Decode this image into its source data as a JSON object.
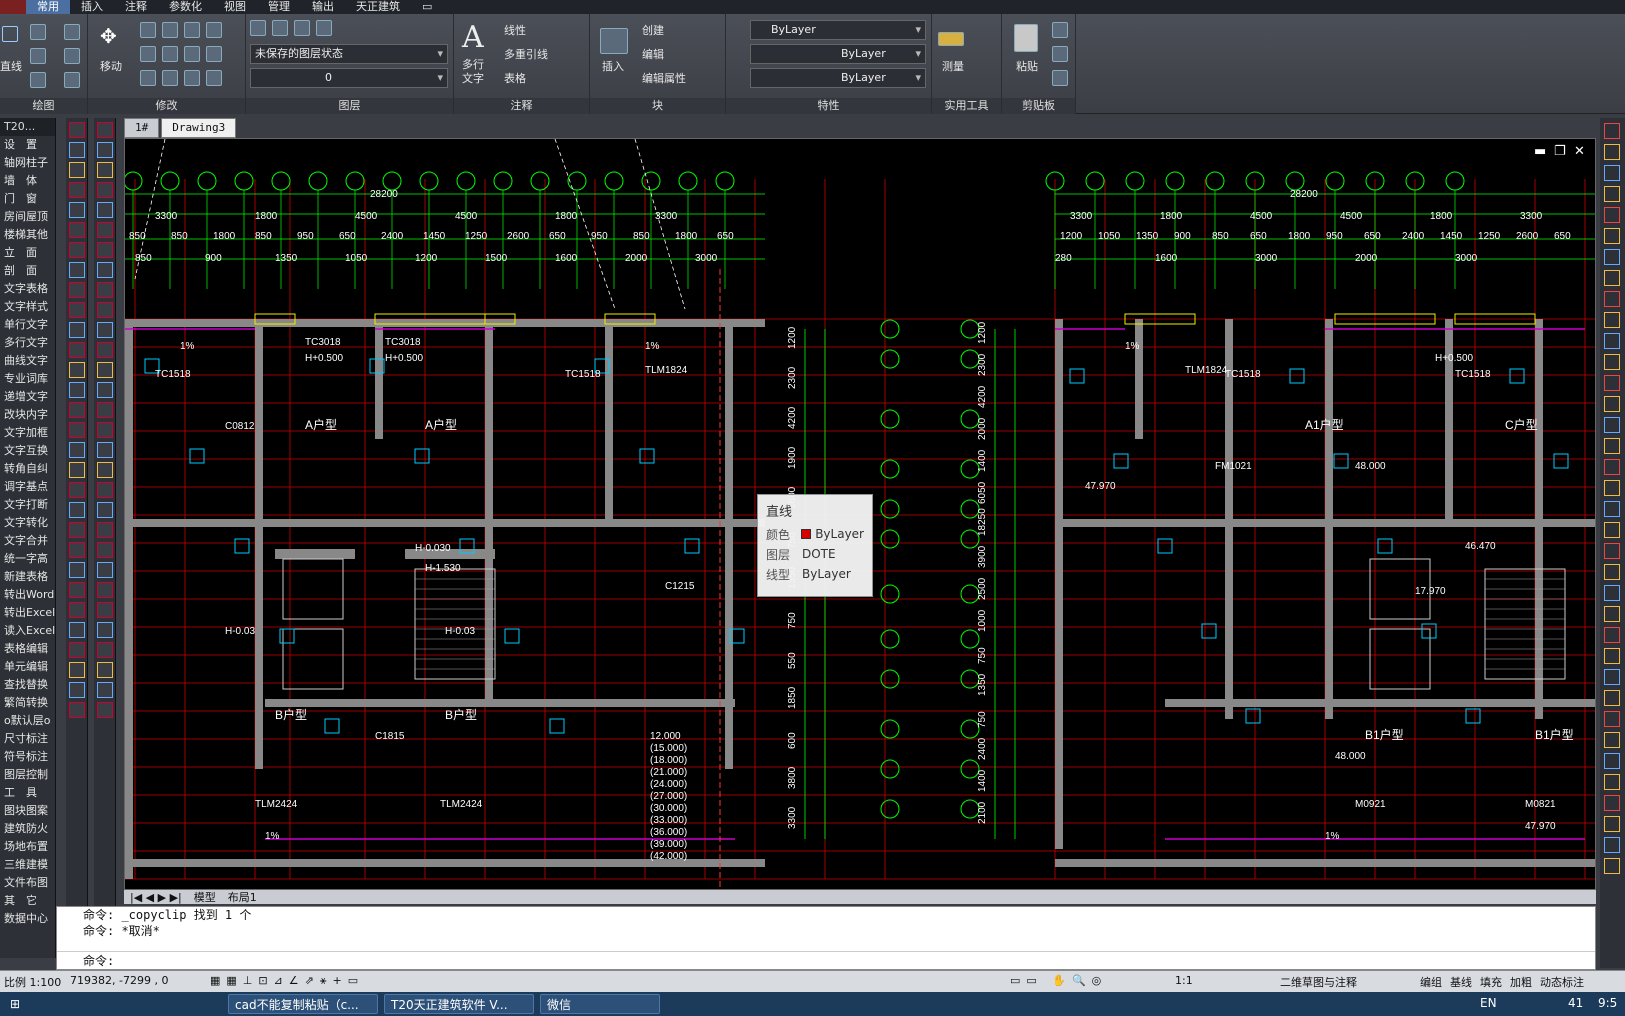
{
  "menu": {
    "tabs": [
      "常用",
      "插入",
      "注释",
      "参数化",
      "视图",
      "管理",
      "输出",
      "天正建筑"
    ]
  },
  "ribbon": {
    "panels": {
      "draw": "绘图",
      "modify": "修改",
      "layers": "图层",
      "annotation": "注释",
      "block": "块",
      "properties": "特性",
      "utilities": "实用工具",
      "clipboard": "剪贴板"
    },
    "draw_line_label": "直线",
    "move_label": "移动",
    "layer_state": "未保存的图层状态",
    "layer_current": "0",
    "multiline_text_label": "多行\n文字",
    "linear_label": "线性",
    "multileader_label": "多重引线",
    "table_label": "表格",
    "insert_label": "插入",
    "create_label": "创建",
    "edit_label": "编辑",
    "edit_attr_label": "编辑属性",
    "color_value": "ByLayer",
    "linetype_value": "ByLayer",
    "lineweight_value": "ByLayer",
    "measure_label": "测量",
    "paste_label": "粘贴"
  },
  "left_palette": {
    "header": "T20...",
    "items": [
      "设　置",
      "轴网柱子",
      "墙　体",
      "门　窗",
      "房间屋顶",
      "楼梯其他",
      "立　面",
      "剖　面",
      "文字表格",
      "文字样式",
      "单行文字",
      "多行文字",
      "曲线文字",
      "专业词库",
      "递增文字",
      "改块内字",
      "文字加框",
      "文字互换",
      "转角自纠",
      "调字基点",
      "文字打断",
      "文字转化",
      "文字合并",
      "统一字高",
      "新建表格",
      "转出Word",
      "转出Excel",
      "读入Excel",
      "表格编辑",
      "单元编辑",
      "查找替换",
      "繁简转换",
      "o默认层o",
      "尺寸标注",
      "符号标注",
      "图层控制",
      "工　具",
      "图块图案",
      "建筑防火",
      "场地布置",
      "三维建模",
      "文件布图",
      "其　它",
      "数据中心"
    ]
  },
  "document": {
    "tabs": [
      "1#",
      "Drawing3"
    ],
    "layout_tabs": [
      "模型",
      "布局1"
    ]
  },
  "tooltip": {
    "title": "直线",
    "color_key": "颜色",
    "color_val": "ByLayer",
    "layer_key": "图层",
    "layer_val": "DOTE",
    "linetype_key": "线型",
    "linetype_val": "ByLayer",
    "swatch_color": "#e00000"
  },
  "drawing": {
    "dims_top_left": [
      "28200",
      "3300",
      "1800",
      "4500",
      "4500",
      "1800",
      "3300",
      "850",
      "850",
      "1800",
      "850",
      "950",
      "650",
      "2400",
      "1450",
      "1250",
      "2600",
      "650",
      "950",
      "850",
      "1800",
      "650",
      "850",
      "900",
      "1350",
      "1050",
      "1200",
      "1500",
      "1600",
      "2000",
      "3000"
    ],
    "dims_top_right": [
      "28200",
      "3300",
      "1800",
      "4500",
      "4500",
      "1800",
      "3300",
      "1200",
      "1050",
      "1350",
      "900",
      "850",
      "650",
      "1800",
      "950",
      "650",
      "2400",
      "1450",
      "1250",
      "2600",
      "650",
      "280",
      "1600",
      "3000",
      "2000",
      "3000"
    ],
    "room_labels": [
      "A户型",
      "A户型",
      "B户型",
      "B户型",
      "A1户型",
      "C户型",
      "B1户型",
      "B1户型"
    ],
    "door_window_tags": [
      "TC3018",
      "TC3018",
      "TC1518",
      "TC1518",
      "TC1518",
      "TC1518",
      "TLM1824",
      "TLM1824",
      "TLM2424",
      "TLM2424",
      "M0921",
      "M0821",
      "C0812",
      "FM1021",
      "C1815",
      "C1215"
    ],
    "elevations": [
      "H+0.500",
      "H+0.500",
      "H-0.030",
      "H-1.530",
      "H-0.03",
      "H-0.03",
      "H+0.500",
      "48.000",
      "47.970",
      "46.470",
      "17.970",
      "48.000",
      "47.970"
    ],
    "level_list": [
      "12.000",
      "(15.000)",
      "(18.000)",
      "(21.000)",
      "(24.000)",
      "(27.000)",
      "(30.000)",
      "(33.000)",
      "(36.000)",
      "(39.000)",
      "(42.000)"
    ],
    "side_dims_left": [
      "1200",
      "2300",
      "4200",
      "1900",
      "1600",
      "750",
      "1350",
      "750",
      "550",
      "1850",
      "600",
      "3800",
      "3300"
    ],
    "side_dims_right": [
      "1200",
      "2300",
      "4200",
      "2000",
      "1400",
      "6050",
      "18250",
      "3900",
      "2500",
      "1000",
      "750",
      "1350",
      "750",
      "2400",
      "1400",
      "2100"
    ],
    "percent_labels": [
      "1%",
      "1%",
      "1%",
      "1%",
      "1%"
    ]
  },
  "command": {
    "lines": [
      "命令: _copyclip 找到 1 个",
      "命令: *取消*"
    ],
    "prompt": "命令:"
  },
  "status": {
    "scale": "比例 1:100",
    "coords": "719382, -7299 , 0",
    "annot_scale": "1:1",
    "workspace": "二维草图与注释",
    "right_buttons": [
      "编组",
      "基线",
      "填充",
      "加粗",
      "动态标注"
    ]
  },
  "taskbar": {
    "items": [
      "cad不能复制粘贴（c...",
      "T20天正建筑软件 V...",
      "微信"
    ],
    "tray": [
      "EN",
      "41",
      "9:5"
    ]
  }
}
